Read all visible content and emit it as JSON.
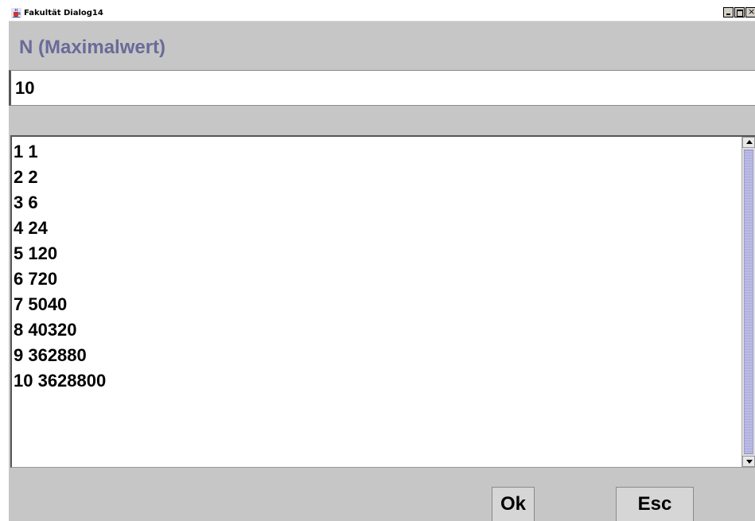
{
  "window": {
    "title": "Fakultät Dialog14",
    "close_glyph": "×"
  },
  "form": {
    "n_label": "N (Maximalwert)",
    "n_value": "10"
  },
  "results": [
    "1 1",
    "2 2",
    "3 6",
    "4 24",
    "5 120",
    "6 720",
    "7 5040",
    "8 40320",
    "9 362880",
    "10 3628800"
  ],
  "buttons": {
    "ok_label": "Ok",
    "esc_label": "Esc"
  },
  "colors": {
    "label": "#6a6a9a",
    "scroll_thumb": "#b3b3dd",
    "panel_bg": "#c6c6c6"
  },
  "icons": {
    "app": "java-cup-icon"
  }
}
